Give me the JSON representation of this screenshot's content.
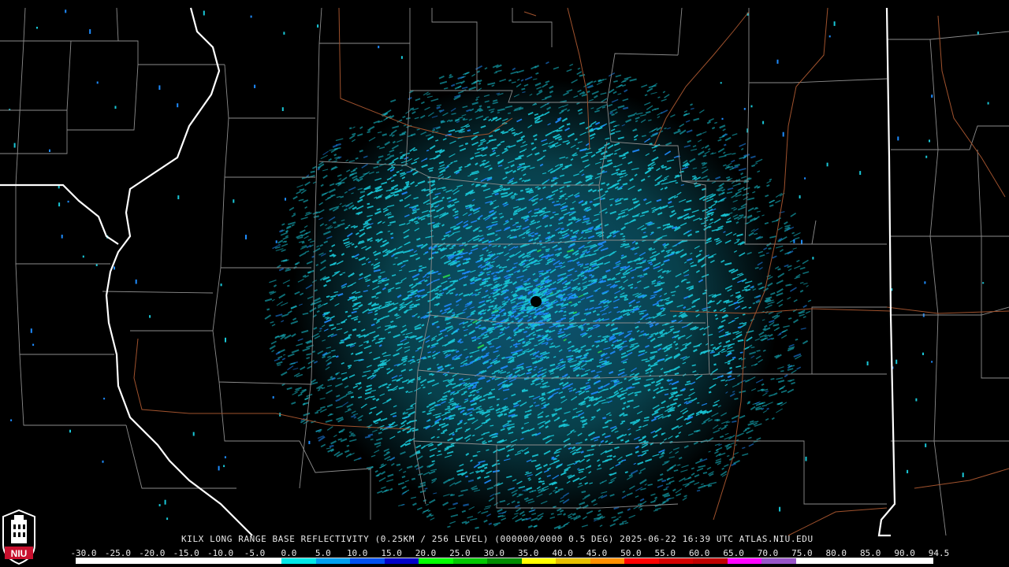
{
  "map": {
    "radar_site": "KILX",
    "product_caption": "KILX LONG RANGE BASE REFLECTIVITY (0.25KM / 256 LEVEL) (000000/0000 0.5 DEG) 2025-06-22 16:39 UTC  ATLAS.NIU.EDU",
    "colors": {
      "background": "#000000",
      "county_lines": "#8c8c8c",
      "state_lines": "#ffffff",
      "rivers": "#a0522d",
      "echo_primary": "#19c8d8",
      "echo_secondary": "#1e8cff",
      "echo_tertiary": "#28d850"
    },
    "scale": {
      "labels": [
        "-30.0",
        "-25.0",
        "-20.0",
        "-15.0",
        "-10.0",
        "-5.0",
        "0.0",
        "5.0",
        "10.0",
        "15.0",
        "20.0",
        "25.0",
        "30.0",
        "35.0",
        "40.0",
        "45.0",
        "50.0",
        "55.0",
        "60.0",
        "65.0",
        "70.0",
        "75.0",
        "80.0",
        "85.0",
        "90.0",
        "94.5"
      ],
      "colors": [
        "#ffffff",
        "#ffffff",
        "#ffffff",
        "#ffffff",
        "#ffffff",
        "#ffffff",
        "#00e8e8",
        "#00a0f0",
        "#0050f0",
        "#0000c8",
        "#00ff00",
        "#00c800",
        "#008c00",
        "#ffff00",
        "#e7c000",
        "#ff9000",
        "#ff0000",
        "#d60000",
        "#c00000",
        "#ff00ff",
        "#9955c9",
        "#ffffff",
        "#ffffff",
        "#ffffff",
        "#ffffff"
      ]
    },
    "logo_text": "NIU",
    "logo_icon": "niu-tower-icon"
  }
}
